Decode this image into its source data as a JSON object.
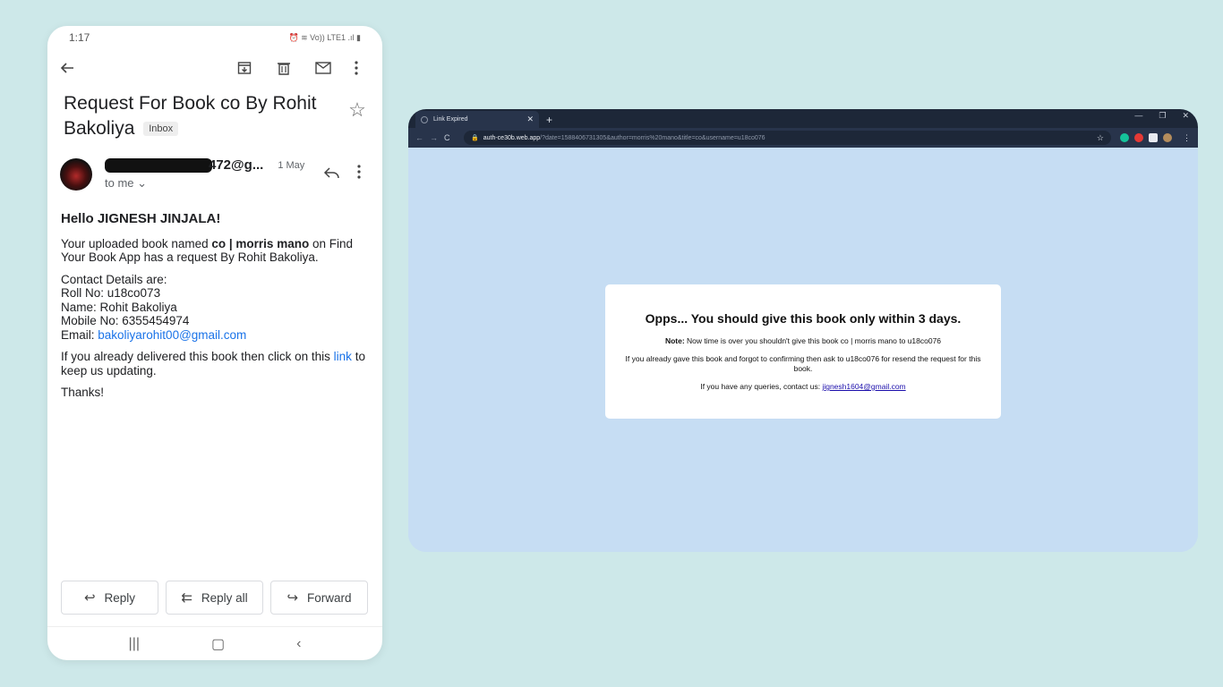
{
  "phone": {
    "status": {
      "time": "1:17",
      "icons": "⏰ ≋ Vo)) LTE1 .ıl ▮"
    },
    "subject": "Request For Book co By Rohit Bakoliya",
    "label": "Inbox",
    "sender": {
      "email_visible": "472@g...",
      "date": "1 May",
      "to": "to me"
    },
    "email": {
      "greeting": "Hello JIGNESH JINJALA!",
      "p1_start": "Your uploaded book named ",
      "p1_book": "co | morris mano",
      "p1_end": " on Find Your Book App has a request By Rohit Bakoliya.",
      "contact_title": "Contact Details are:",
      "roll": "Roll No: u18co073",
      "name": "Name: Rohit Bakoliya",
      "mobile": "Mobile No: 6355454974",
      "email_label": "Email: ",
      "email_link": "bakoliyarohit00@gmail.com",
      "p3_start": "If you already delivered this book then click on this ",
      "p3_link": "link",
      "p3_end": " to keep us updating.",
      "thanks": "Thanks!"
    },
    "actions": {
      "reply": "Reply",
      "reply_all": "Reply all",
      "forward": "Forward"
    }
  },
  "browser": {
    "tab_title": "Link Expired",
    "url_host": "auth-ce30b.web.app",
    "url_path": "/?date=1588406731305&author=morris%20mano&title=co&username=u18co076",
    "card": {
      "heading": "Opps... You should give this book only within 3 days.",
      "note_label": "Note:",
      "note_text": " Now time is over you shouldn't give this book co | morris mano to u18co076",
      "resend": "If you already gave this book and forgot to confirming then ask to u18co076 for resend the request for this book.",
      "contact_prefix": "If you have any queries, contact us: ",
      "contact_email": "jignesh1604@gmail.com"
    }
  },
  "icons": [
    "back-arrow-icon",
    "archive-icon",
    "delete-icon",
    "mail-icon",
    "more-vert-icon",
    "star-icon",
    "reply-icon",
    "reply-all-icon",
    "forward-icon",
    "recents-icon",
    "home-icon",
    "nav-back-icon",
    "lock-icon",
    "reload-icon"
  ]
}
